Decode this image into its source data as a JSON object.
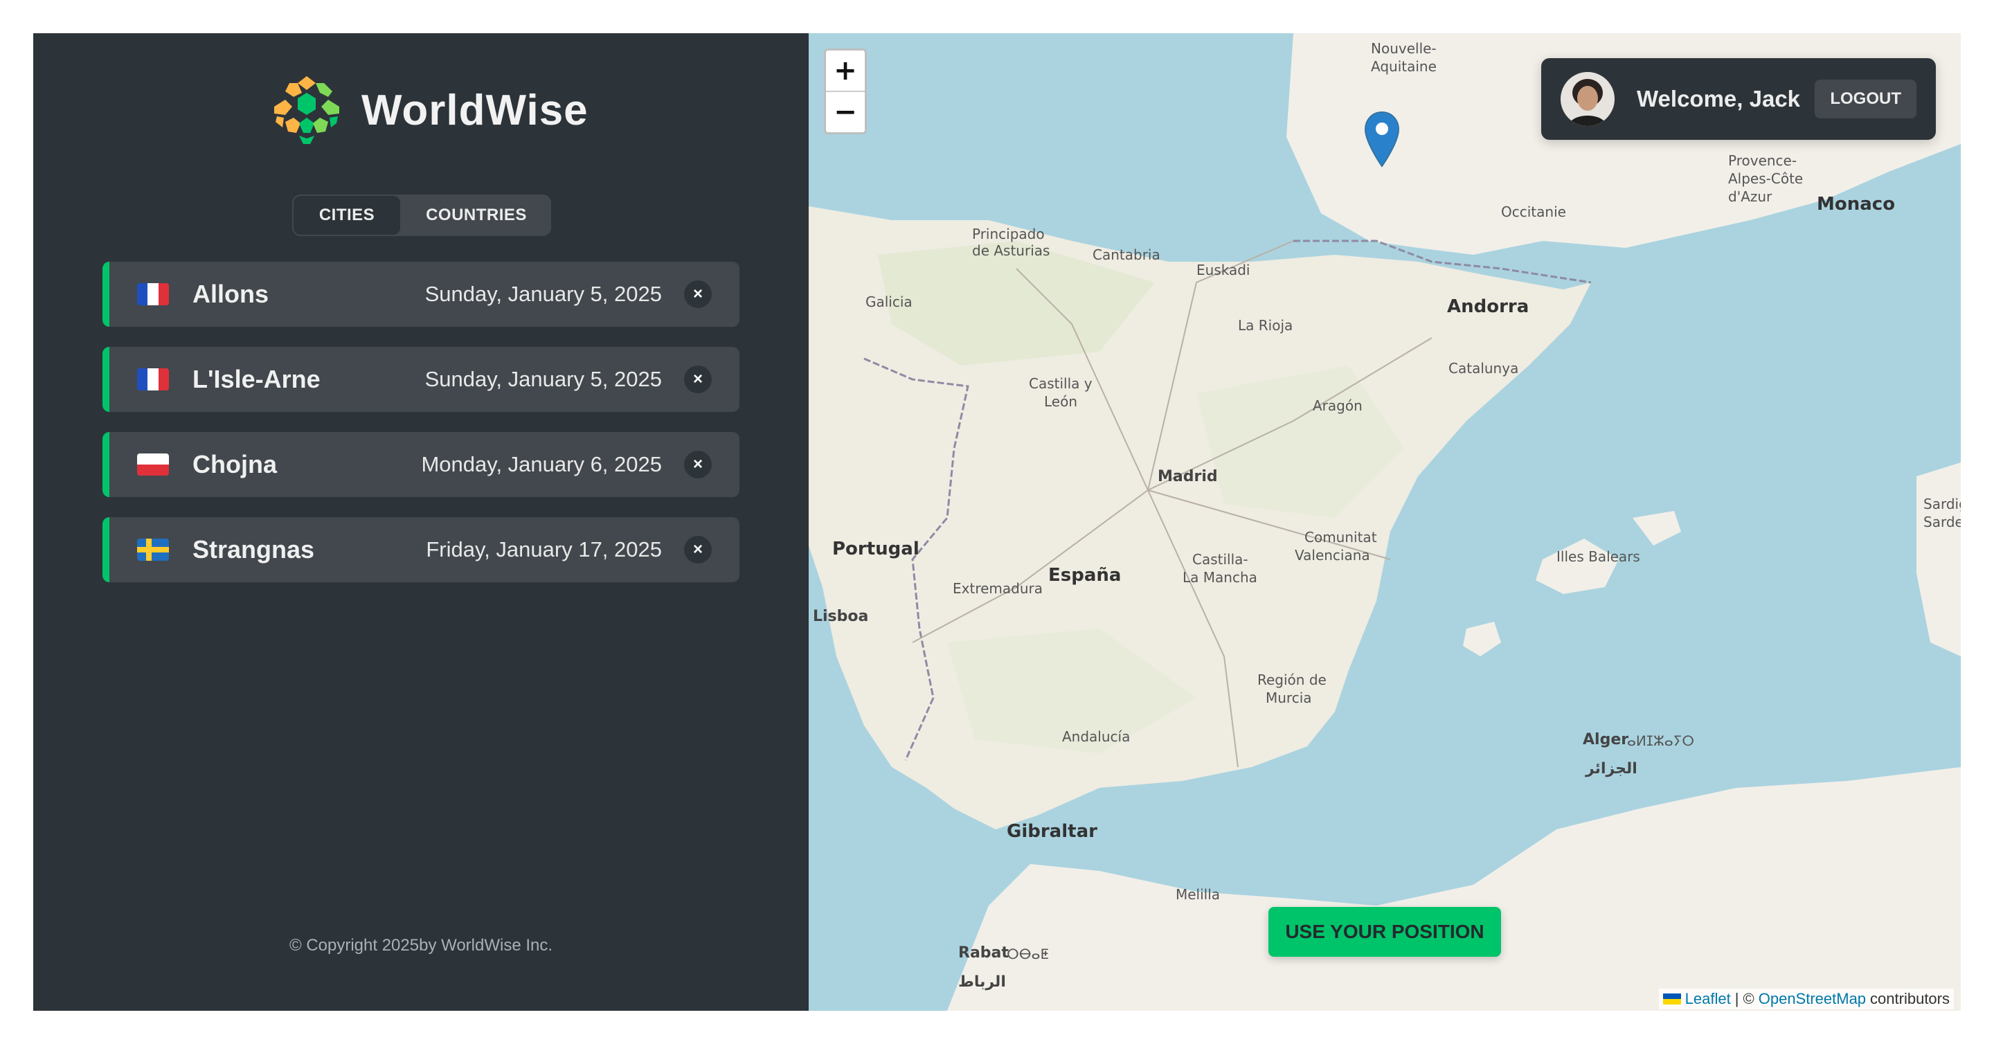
{
  "brand": {
    "name": "WorldWise"
  },
  "tabs": [
    {
      "label": "Cities",
      "active": true
    },
    {
      "label": "Countries",
      "active": false
    }
  ],
  "cities": [
    {
      "flag": "France",
      "name": "Allons",
      "date": "Sunday, January 5, 2025",
      "delete": "×"
    },
    {
      "flag": "France",
      "name": "L'Isle-Arne",
      "date": "Sunday, January 5, 2025",
      "delete": "×"
    },
    {
      "flag": "Poland",
      "name": "Chojna",
      "date": "Monday, January 6, 2025",
      "delete": "×"
    },
    {
      "flag": "Sweden",
      "name": "Strangnas",
      "date": "Friday, January 17, 2025",
      "delete": "×"
    }
  ],
  "footer": {
    "copyright": "© Copyright 2025by WorldWise Inc."
  },
  "map": {
    "zoom_in": "+",
    "zoom_out": "−",
    "user": {
      "welcome": "Welcome, Jack",
      "logout": "Logout"
    },
    "use_position": "Use your position",
    "attribution": {
      "leaflet": "Leaflet",
      "sep": "| ©",
      "osm": "OpenStreetMap",
      "contributors": "contributors"
    },
    "labels": {
      "nouvelle": "Nouvelle-",
      "aquitaine": "Aquitaine",
      "occitanie": "Occitanie",
      "provence": "Provence-",
      "alpes": "Alpes-Côte",
      "dazur": "d'Azur",
      "monaco": "Monaco",
      "andorra": "Andorra",
      "principado": "Principado",
      "asturias": "de Asturias",
      "cantabria": "Cantabria",
      "euskadi": "Euskadi",
      "galicia": "Galicia",
      "larioja": "La Rioja",
      "catalunya": "Catalunya",
      "castilla1": "Castilla y",
      "leon": "León",
      "aragon": "Aragón",
      "madrid": "Madrid",
      "portugal": "Portugal",
      "espana": "España",
      "extremadura": "Extremadura",
      "castilla2": "Castilla-",
      "lamancha": "La Mancha",
      "comunitat": "Comunitat",
      "valenciana": "Valenciana",
      "illes": "Illes Balears",
      "lisboa": "Lisboa",
      "region": "Región de",
      "murcia": "Murcia",
      "andalucia": "Andalucía",
      "alger": "Alger",
      "alger_ar": "ⴰⵍⵊⵣⴰⵢⵔ",
      "aljazair": "الجزائر",
      "gibraltar": "Gibraltar",
      "melilla": "Melilla",
      "rabat": "Rabat",
      "rabat_tz": "ⵔⴱⴰⵟ",
      "ribat": "الرباط",
      "sardegna1": "Sardig",
      "sardegna2": "Sarde"
    }
  },
  "colors": {
    "sidebar": "#2d3439",
    "panel": "#42484d",
    "accent": "#00c46a",
    "sea": "#aad3df",
    "land": "#f2efe9"
  }
}
